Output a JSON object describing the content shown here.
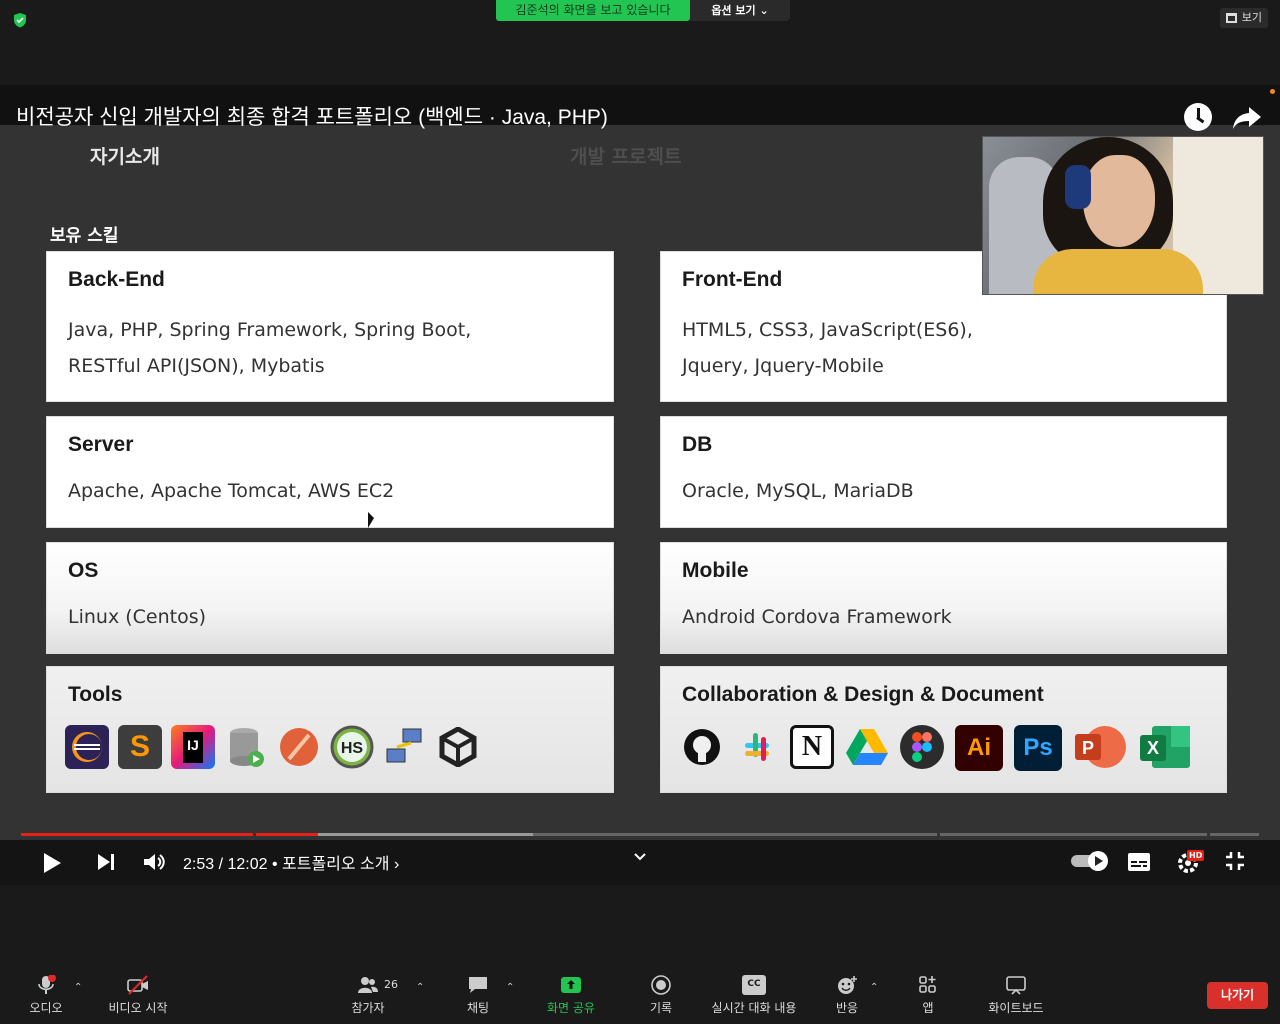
{
  "zoom_top": {
    "sharing_banner": "김준석의 화면을 보고 있습니다",
    "options": "옵션 보기 ⌄",
    "view": "보기"
  },
  "video": {
    "title": "비전공자 신입 개발자의 최종 합격 포트폴리오 (백엔드 · Java, PHP)",
    "tabs": [
      "자기소개",
      "개발 프로젝트"
    ],
    "section": "보유 스킬",
    "cards": {
      "backend": {
        "title": "Back-End",
        "lines": [
          "Java, PHP, Spring Framework, Spring Boot,",
          "RESTful API(JSON), Mybatis"
        ]
      },
      "frontend": {
        "title": "Front-End",
        "lines": [
          "HTML5, CSS3, JavaScript(ES6),",
          "Jquery, Jquery-Mobile"
        ]
      },
      "server": {
        "title": "Server",
        "lines": [
          "Apache, Apache Tomcat, AWS EC2"
        ]
      },
      "db": {
        "title": "DB",
        "lines": [
          "Oracle, MySQL, MariaDB"
        ]
      },
      "os": {
        "title": "OS",
        "lines": [
          "Linux (Centos)"
        ]
      },
      "mobile": {
        "title": "Mobile",
        "lines": [
          "Android Cordova Framework"
        ]
      },
      "tools": {
        "title": "Tools",
        "icons": [
          "eclipse-icon",
          "sublime-text-icon",
          "intellij-icon",
          "database-icon",
          "postman-icon",
          "heidisql-icon",
          "network-icon",
          "unity-icon"
        ]
      },
      "collab": {
        "title": "Collaboration & Design & Document",
        "icons": [
          "github-icon",
          "slack-icon",
          "notion-icon",
          "google-drive-icon",
          "figma-icon",
          "illustrator-icon",
          "photoshop-icon",
          "powerpoint-icon",
          "excel-icon"
        ]
      }
    },
    "icon_text": {
      "intellij": "IJ",
      "heidisql": "HS",
      "notion": "N",
      "illustrator": "Ai",
      "photoshop": "Ps",
      "powerpoint": "P",
      "excel": "X"
    },
    "player": {
      "time": "2:53 / 12:02",
      "chapter": "• 포트폴리오 소개 ›",
      "progress_fraction": 0.24,
      "hd_badge": "HD"
    }
  },
  "zoom_bottom": {
    "audio": "오디오",
    "video": "비디오 시작",
    "participants": "참가자",
    "participants_count": "26",
    "chat": "채팅",
    "share": "화면 공유",
    "record": "기록",
    "captions": "실시간 대화 내용",
    "captions_icon_text": "CC",
    "reactions": "반응",
    "apps": "앱",
    "whiteboard": "화이트보드",
    "leave": "나가기"
  },
  "colors": {
    "zoom_green": "#23c552",
    "leave_red": "#d9302b",
    "progress_red": "#e62117"
  }
}
